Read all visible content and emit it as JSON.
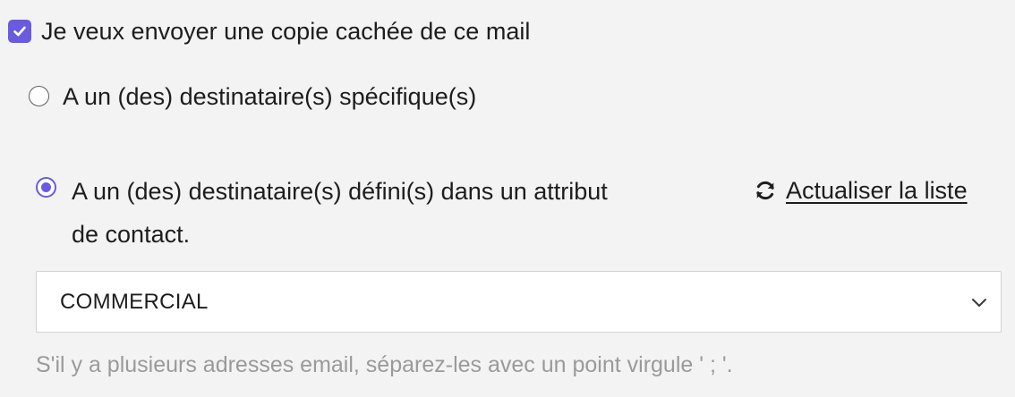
{
  "bcc_checkbox": {
    "label": "Je veux envoyer une copie cachée de ce mail",
    "checked": true
  },
  "recipient_options": {
    "specific": {
      "label": "A un (des) destinataire(s) spécifique(s)",
      "selected": false
    },
    "attribute": {
      "label_line1": "A un (des) destinataire(s) défini(s) dans un attribut",
      "label_line2": "de contact.",
      "selected": true
    }
  },
  "refresh_link": {
    "label": " Actualiser la liste",
    "icon": "refresh-icon"
  },
  "attribute_select": {
    "value": "COMMERCIAL",
    "icon": "chevron-down-icon"
  },
  "hint_text": "S'il y a plusieurs adresses email, séparez-les avec un point virgule ' ; '.",
  "colors": {
    "accent": "#6a5ae0",
    "background": "#f3f3f3",
    "hint": "#9a9a9a"
  }
}
